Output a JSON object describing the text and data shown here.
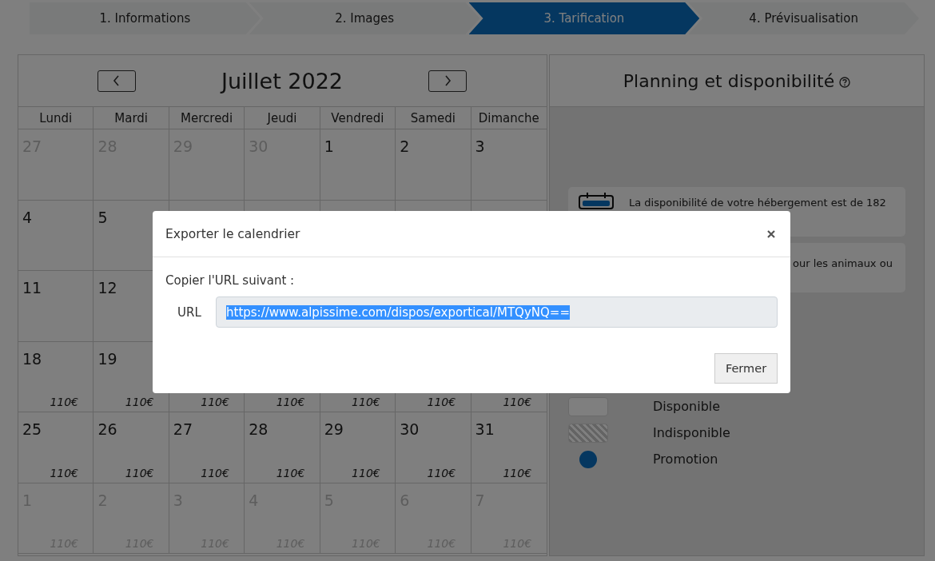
{
  "steps": [
    {
      "label": "1. Informations",
      "selected": false
    },
    {
      "label": "2. Images",
      "selected": false
    },
    {
      "label": "3. Tarification",
      "selected": true
    },
    {
      "label": "4. Prévisualisation",
      "selected": false
    }
  ],
  "calendar": {
    "title": "Juillet 2022",
    "weekdays": [
      "Lundi",
      "Mardi",
      "Mercredi",
      "Jeudi",
      "Vendredi",
      "Samedi",
      "Dimanche"
    ],
    "weeks": [
      [
        {
          "day": "27",
          "muted": true
        },
        {
          "day": "28",
          "muted": true
        },
        {
          "day": "29",
          "muted": true
        },
        {
          "day": "30",
          "muted": true
        },
        {
          "day": "1",
          "muted": false
        },
        {
          "day": "2",
          "muted": false
        },
        {
          "day": "3",
          "muted": false
        }
      ],
      [
        {
          "day": "4",
          "muted": false
        },
        {
          "day": "5",
          "muted": false
        }
      ],
      [
        {
          "day": "11",
          "muted": false
        },
        {
          "day": "12",
          "muted": false
        }
      ],
      [
        {
          "day": "18",
          "muted": false,
          "price": "110€"
        },
        {
          "day": "19",
          "muted": false,
          "price": "110€"
        },
        {
          "muted": false,
          "price": "110€"
        },
        {
          "muted": false,
          "price": "110€"
        },
        {
          "muted": false,
          "price": "110€"
        },
        {
          "muted": false,
          "price": "110€"
        },
        {
          "muted": false,
          "price": "110€"
        }
      ],
      [
        {
          "day": "25",
          "muted": false,
          "price": "110€"
        },
        {
          "day": "26",
          "muted": false,
          "price": "110€"
        },
        {
          "day": "27",
          "muted": false,
          "price": "110€"
        },
        {
          "day": "28",
          "muted": false,
          "price": "110€"
        },
        {
          "day": "29",
          "muted": false,
          "price": "110€"
        },
        {
          "day": "30",
          "muted": false,
          "price": "110€"
        },
        {
          "day": "31",
          "muted": false,
          "price": "110€"
        }
      ],
      [
        {
          "day": "1",
          "muted": true,
          "price": "110€"
        },
        {
          "day": "2",
          "muted": true,
          "price": "110€"
        },
        {
          "day": "3",
          "muted": true,
          "price": "110€"
        },
        {
          "day": "4",
          "muted": true,
          "price": "110€"
        },
        {
          "day": "5",
          "muted": true,
          "price": "110€"
        },
        {
          "day": "6",
          "muted": true,
          "price": "110€"
        },
        {
          "day": "7",
          "muted": true,
          "price": "110€"
        }
      ]
    ]
  },
  "planning": {
    "title": "Planning et disponibilité",
    "cards": [
      {
        "kind": "calendar",
        "text": "La disponibilité de votre hébergement est de 182"
      },
      {
        "kind": "plain",
        "text": "our les animaux ou"
      }
    ],
    "legend": [
      {
        "kind": "available",
        "label": "Disponible"
      },
      {
        "kind": "unavailable",
        "label": "Indisponible"
      },
      {
        "kind": "promotion",
        "label": "Promotion"
      }
    ]
  },
  "modal": {
    "title": "Exporter le calendrier",
    "instruction": "Copier l'URL suivant :",
    "url_label": "URL",
    "url": "https://www.alpissime.com/dispos/exportical/MTQyNQ==",
    "url_selected": true,
    "close_button": "Fermer"
  }
}
